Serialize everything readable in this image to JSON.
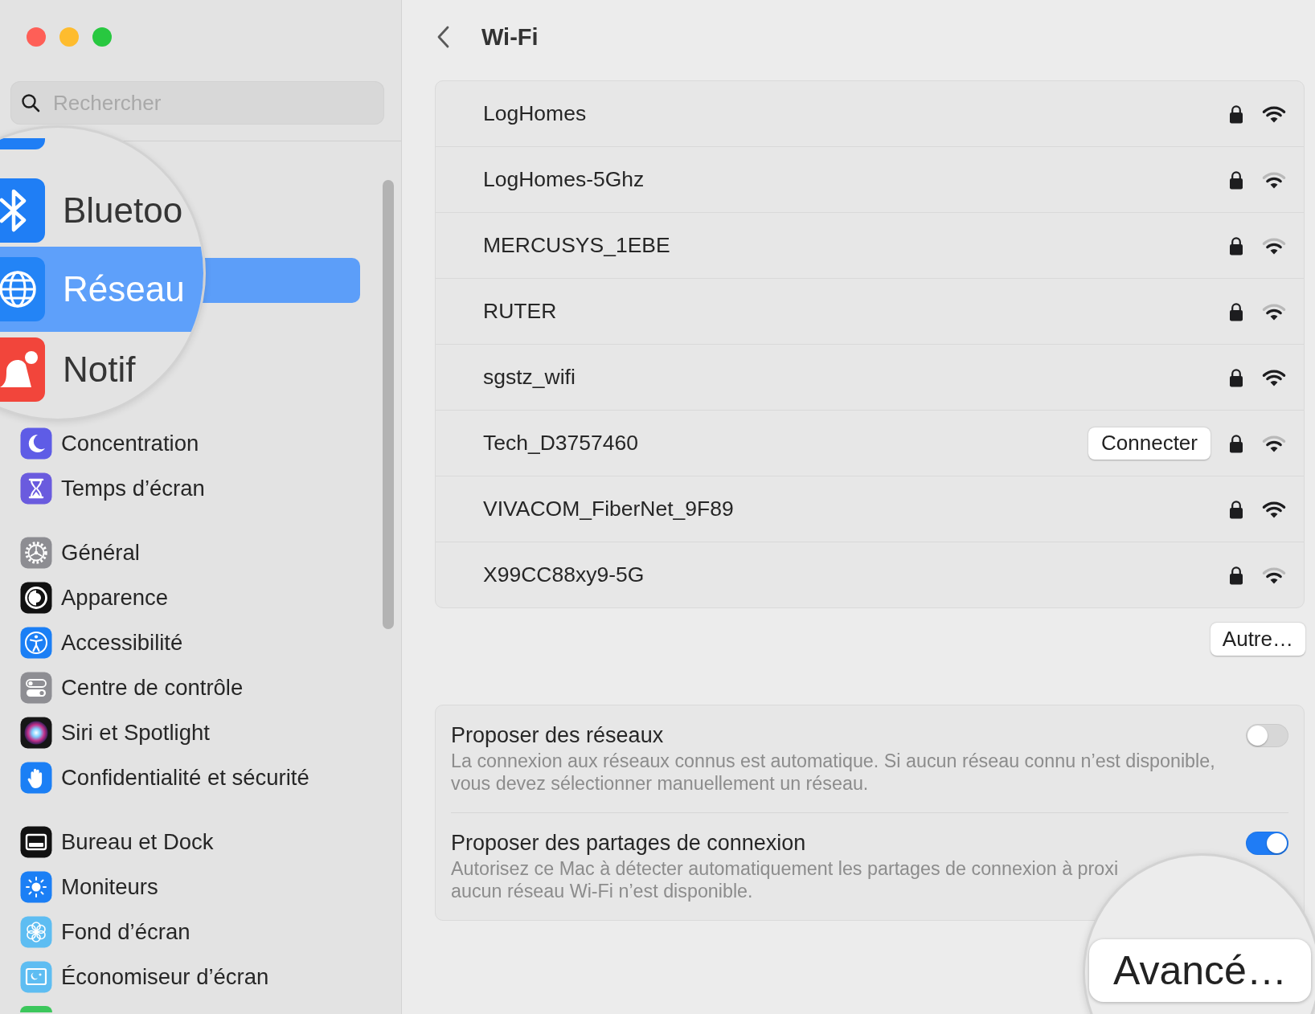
{
  "sidebar": {
    "search": {
      "placeholder": "Rechercher"
    },
    "magnifier": {
      "items": [
        {
          "label": "Bluetoo",
          "selected": false
        },
        {
          "label": "Réseau",
          "selected": true
        },
        {
          "label": "Notif",
          "selected": false
        }
      ]
    },
    "groups": [
      {
        "items": [
          {
            "label": "Concentration",
            "selected": false
          },
          {
            "label": "Temps d’écran",
            "selected": false
          }
        ]
      },
      {
        "items": [
          {
            "label": "Général",
            "selected": false
          },
          {
            "label": "Apparence",
            "selected": false
          },
          {
            "label": "Accessibilité",
            "selected": false
          },
          {
            "label": "Centre de contrôle",
            "selected": false
          },
          {
            "label": "Siri et Spotlight",
            "selected": false
          },
          {
            "label": "Confidentialité et sécurité",
            "selected": false
          }
        ]
      },
      {
        "items": [
          {
            "label": "Bureau et Dock",
            "selected": false
          },
          {
            "label": "Moniteurs",
            "selected": false
          },
          {
            "label": "Fond d’écran",
            "selected": false
          },
          {
            "label": "Économiseur d’écran",
            "selected": false
          }
        ]
      }
    ]
  },
  "wifi": {
    "title": "Wi-Fi",
    "networks": [
      {
        "name": "LogHomes",
        "secured": true,
        "strong_signal": true
      },
      {
        "name": "LogHomes-5Ghz",
        "secured": true,
        "strong_signal": false
      },
      {
        "name": "MERCUSYS_1EBE",
        "secured": true,
        "strong_signal": false
      },
      {
        "name": "RUTER",
        "secured": true,
        "strong_signal": false
      },
      {
        "name": "sgstz_wifi",
        "secured": true,
        "strong_signal": true
      },
      {
        "name": "Tech_D3757460",
        "secured": true,
        "strong_signal": false,
        "action": "Connecter"
      },
      {
        "name": "VIVACOM_FiberNet_9F89",
        "secured": true,
        "strong_signal": true
      },
      {
        "name": "X99CC88xy9-5G",
        "secured": true,
        "strong_signal": false
      }
    ],
    "other_button": "Autre…",
    "options": [
      {
        "title": "Proposer des réseaux",
        "description": "La connexion aux réseaux connus est automatique. Si aucun réseau connu n’est disponible,\nvous devez sélectionner manuellement un réseau.",
        "on": false
      },
      {
        "title": "Proposer des partages de connexion",
        "description": "Autorisez ce Mac à détecter automatiquement les partages de connexion à proxi\naucun réseau Wi-Fi n’est disponible.",
        "on": true
      }
    ],
    "magnifier": {
      "button": "Avancé…"
    }
  }
}
